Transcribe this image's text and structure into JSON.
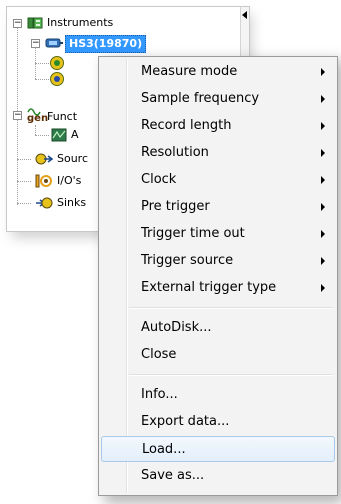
{
  "tree": {
    "instruments_label": "Instruments",
    "selected_instrument_label": "HS3(19870)",
    "functions_label_visible": "Funct",
    "function_child_label_visible": "A",
    "sources_label_visible": "Sourc",
    "ios_label_visible": "I/O's",
    "sinks_label_visible": "Sinks",
    "expander_minus": "−",
    "functions_icon_text": "gen"
  },
  "context_menu": {
    "items": [
      {
        "label": "Measure mode",
        "has_submenu": true
      },
      {
        "label": "Sample frequency",
        "has_submenu": true
      },
      {
        "label": "Record length",
        "has_submenu": true
      },
      {
        "label": "Resolution",
        "has_submenu": true
      },
      {
        "label": "Clock",
        "has_submenu": true
      },
      {
        "label": "Pre trigger",
        "has_submenu": true
      },
      {
        "label": "Trigger time out",
        "has_submenu": true
      },
      {
        "label": "Trigger source",
        "has_submenu": true
      },
      {
        "label": "External trigger type",
        "has_submenu": true
      },
      {
        "label": "AutoDisk...",
        "has_submenu": false
      },
      {
        "label": "Close",
        "has_submenu": false
      },
      {
        "label": "Info...",
        "has_submenu": false
      },
      {
        "label": "Export data...",
        "has_submenu": false
      },
      {
        "label": "Load...",
        "has_submenu": false,
        "highlighted": true
      },
      {
        "label": "Save as...",
        "has_submenu": false
      }
    ]
  },
  "colors": {
    "selection": "#3399ff",
    "menu_background": "#f3f3f3",
    "hover_border": "#a9c9e8"
  }
}
